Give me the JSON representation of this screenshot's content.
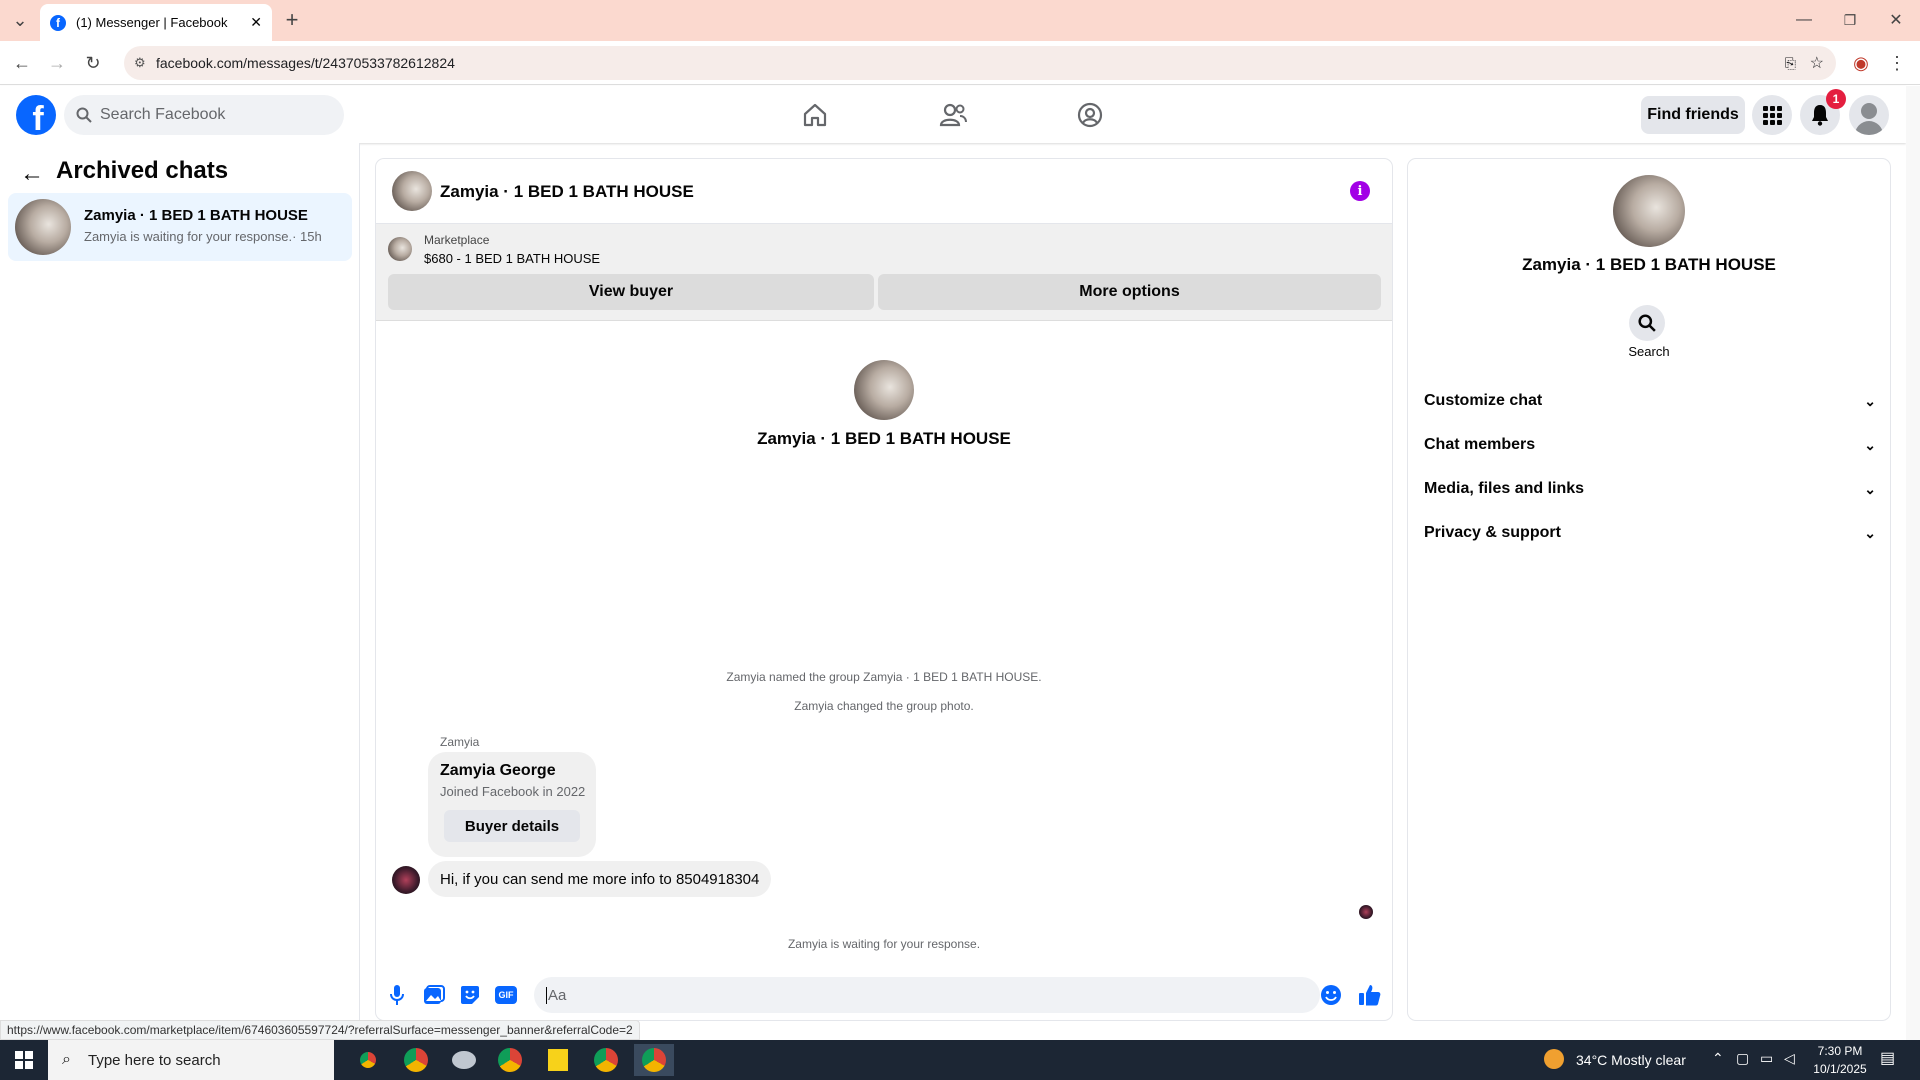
{
  "browser": {
    "tab_title": "(1) Messenger | Facebook",
    "url": "facebook.com/messages/t/24370533782612824",
    "status_url": "https://www.facebook.com/marketplace/item/674603605597724/?referralSurface=messenger_banner&referralCode=2"
  },
  "header": {
    "search_placeholder": "Search Facebook",
    "find_friends": "Find friends",
    "notification_count": "1"
  },
  "sidebar": {
    "title": "Archived chats",
    "chats": [
      {
        "name": "Zamyia · 1 BED 1 BATH HOUSE",
        "preview": "Zamyia is waiting for your response.· 15h"
      }
    ]
  },
  "conversation": {
    "title": "Zamyia · 1 BED 1 BATH HOUSE",
    "marketplace": {
      "label": "Marketplace",
      "listing": "$680 - 1 BED 1 BATH HOUSE",
      "view_buyer": "View buyer",
      "more_options": "More options"
    },
    "intro_name": "Zamyia · 1 BED 1 BATH HOUSE",
    "system_messages": [
      "Zamyia named the group Zamyia · 1 BED 1 BATH HOUSE.",
      "Zamyia changed the group photo."
    ],
    "sender_label": "Zamyia",
    "card": {
      "name": "Zamyia George",
      "joined": "Joined Facebook in 2022",
      "button": "Buyer details"
    },
    "message": "Hi, if you can send me more info to 8504918304",
    "waiting": "Zamyia is waiting for your response.",
    "composer_placeholder": "Aa"
  },
  "details": {
    "name": "Zamyia · 1 BED 1 BATH HOUSE",
    "search_label": "Search",
    "sections": [
      "Customize chat",
      "Chat members",
      "Media, files and links",
      "Privacy & support"
    ]
  },
  "taskbar": {
    "search_placeholder": "Type here to search",
    "weather": "34°C  Mostly clear",
    "time": "7:30 PM",
    "date": "10/1/2025"
  },
  "colors": {
    "brand": "#0866ff",
    "accent_purple": "#a200e6"
  }
}
